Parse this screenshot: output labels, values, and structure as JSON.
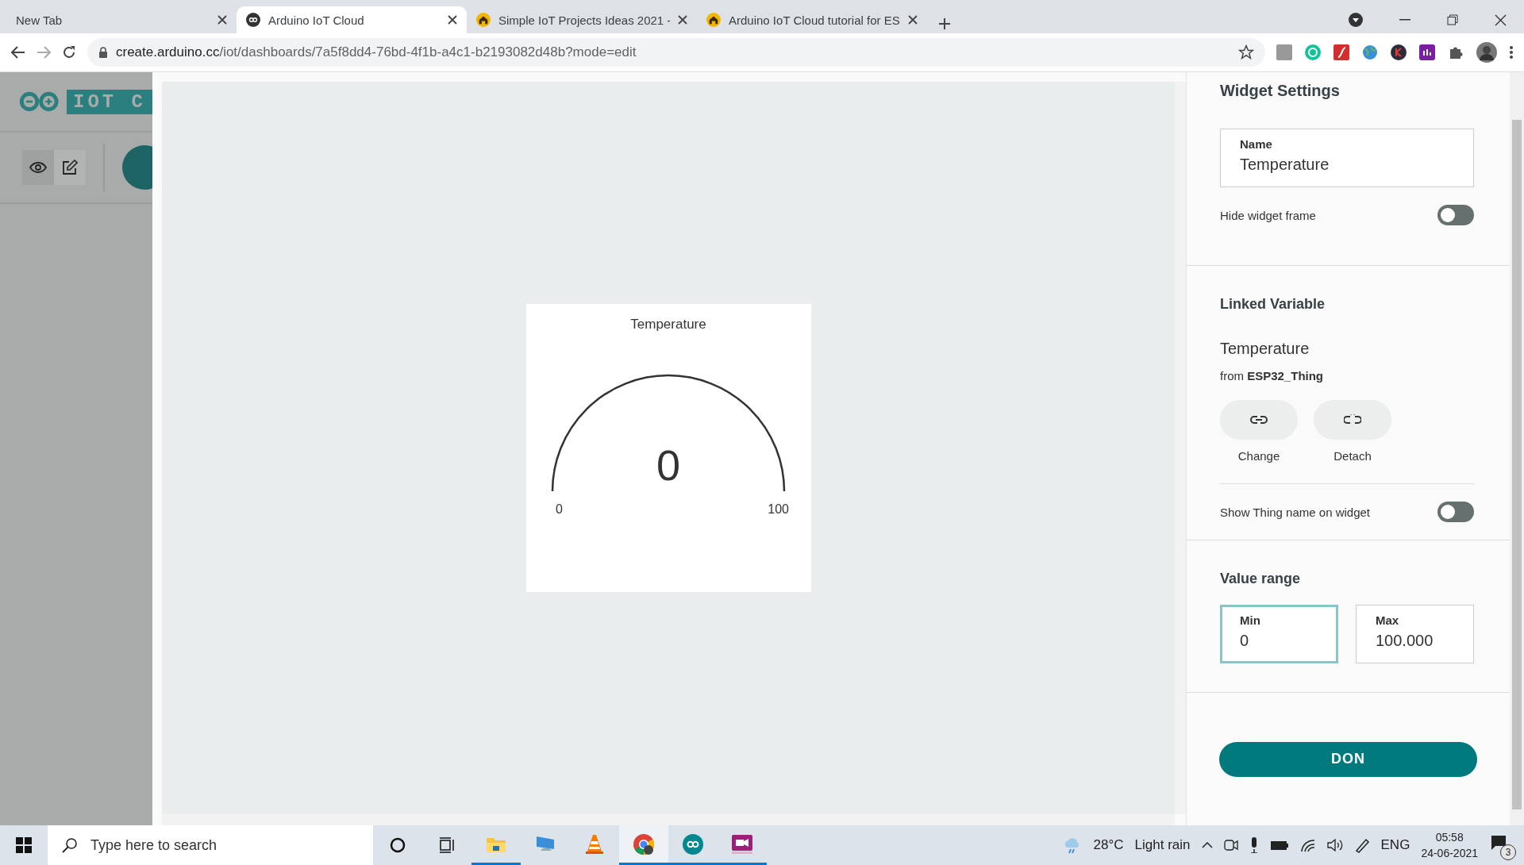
{
  "browser": {
    "tabs": [
      {
        "title": "New Tab",
        "kind": "blank",
        "selected": false
      },
      {
        "title": "Arduino IoT Cloud",
        "kind": "infinity",
        "selected": true
      },
      {
        "title": "Simple IoT Projects Ideas 2021 -",
        "kind": "house",
        "selected": false
      },
      {
        "title": "Arduino IoT Cloud tutorial for ES",
        "kind": "house",
        "selected": false
      }
    ],
    "url_host": "create.arduino.cc",
    "url_path": "/iot/dashboards/7a5f8dd4-76bd-4f1b-a4c1-b2193082d48b?mode=edit"
  },
  "sidebar": {
    "logo_text": "IOT C",
    "modes": [
      {
        "kind": "view",
        "selected": false
      },
      {
        "kind": "edit",
        "selected": true
      }
    ]
  },
  "widget": {
    "title": "Temperature",
    "value": "0",
    "min_label": "0",
    "max_label": "100"
  },
  "settings": {
    "title": "Widget Settings",
    "name_label": "Name",
    "name_value": "Temperature",
    "hide_frame": {
      "label": "Hide widget frame",
      "on": false
    },
    "linked_variable": {
      "heading": "Linked Variable",
      "name": "Temperature",
      "source": "from **ESP32_Thing**",
      "actions": [
        {
          "label": "Change",
          "kind": "link"
        },
        {
          "label": "Detach",
          "kind": "unlink"
        }
      ]
    },
    "show_thing_name": {
      "label": "Show Thing name on widget",
      "on": false
    },
    "value_range": {
      "heading": "Value range",
      "fields": [
        {
          "label": "Min",
          "value": "0",
          "selected": true
        },
        {
          "label": "Max",
          "value": "100.000",
          "selected": false
        }
      ]
    },
    "done_button": "DON"
  },
  "taskbar": {
    "search_placeholder": "Type here to search",
    "apps": [
      {
        "kind": "folder",
        "running": true,
        "selected": false
      },
      {
        "kind": "computer",
        "running": false,
        "selected": false
      },
      {
        "kind": "cone",
        "running": false,
        "selected": false
      },
      {
        "kind": "chrome",
        "running": true,
        "selected": true
      },
      {
        "kind": "infinity",
        "running": true,
        "selected": false
      },
      {
        "kind": "video",
        "running": true,
        "selected": false
      }
    ],
    "temperature": "28°C",
    "weather": "Light rain",
    "language": "ENG",
    "time": "05:58",
    "date": "24-06-2021",
    "notifications": "3"
  }
}
